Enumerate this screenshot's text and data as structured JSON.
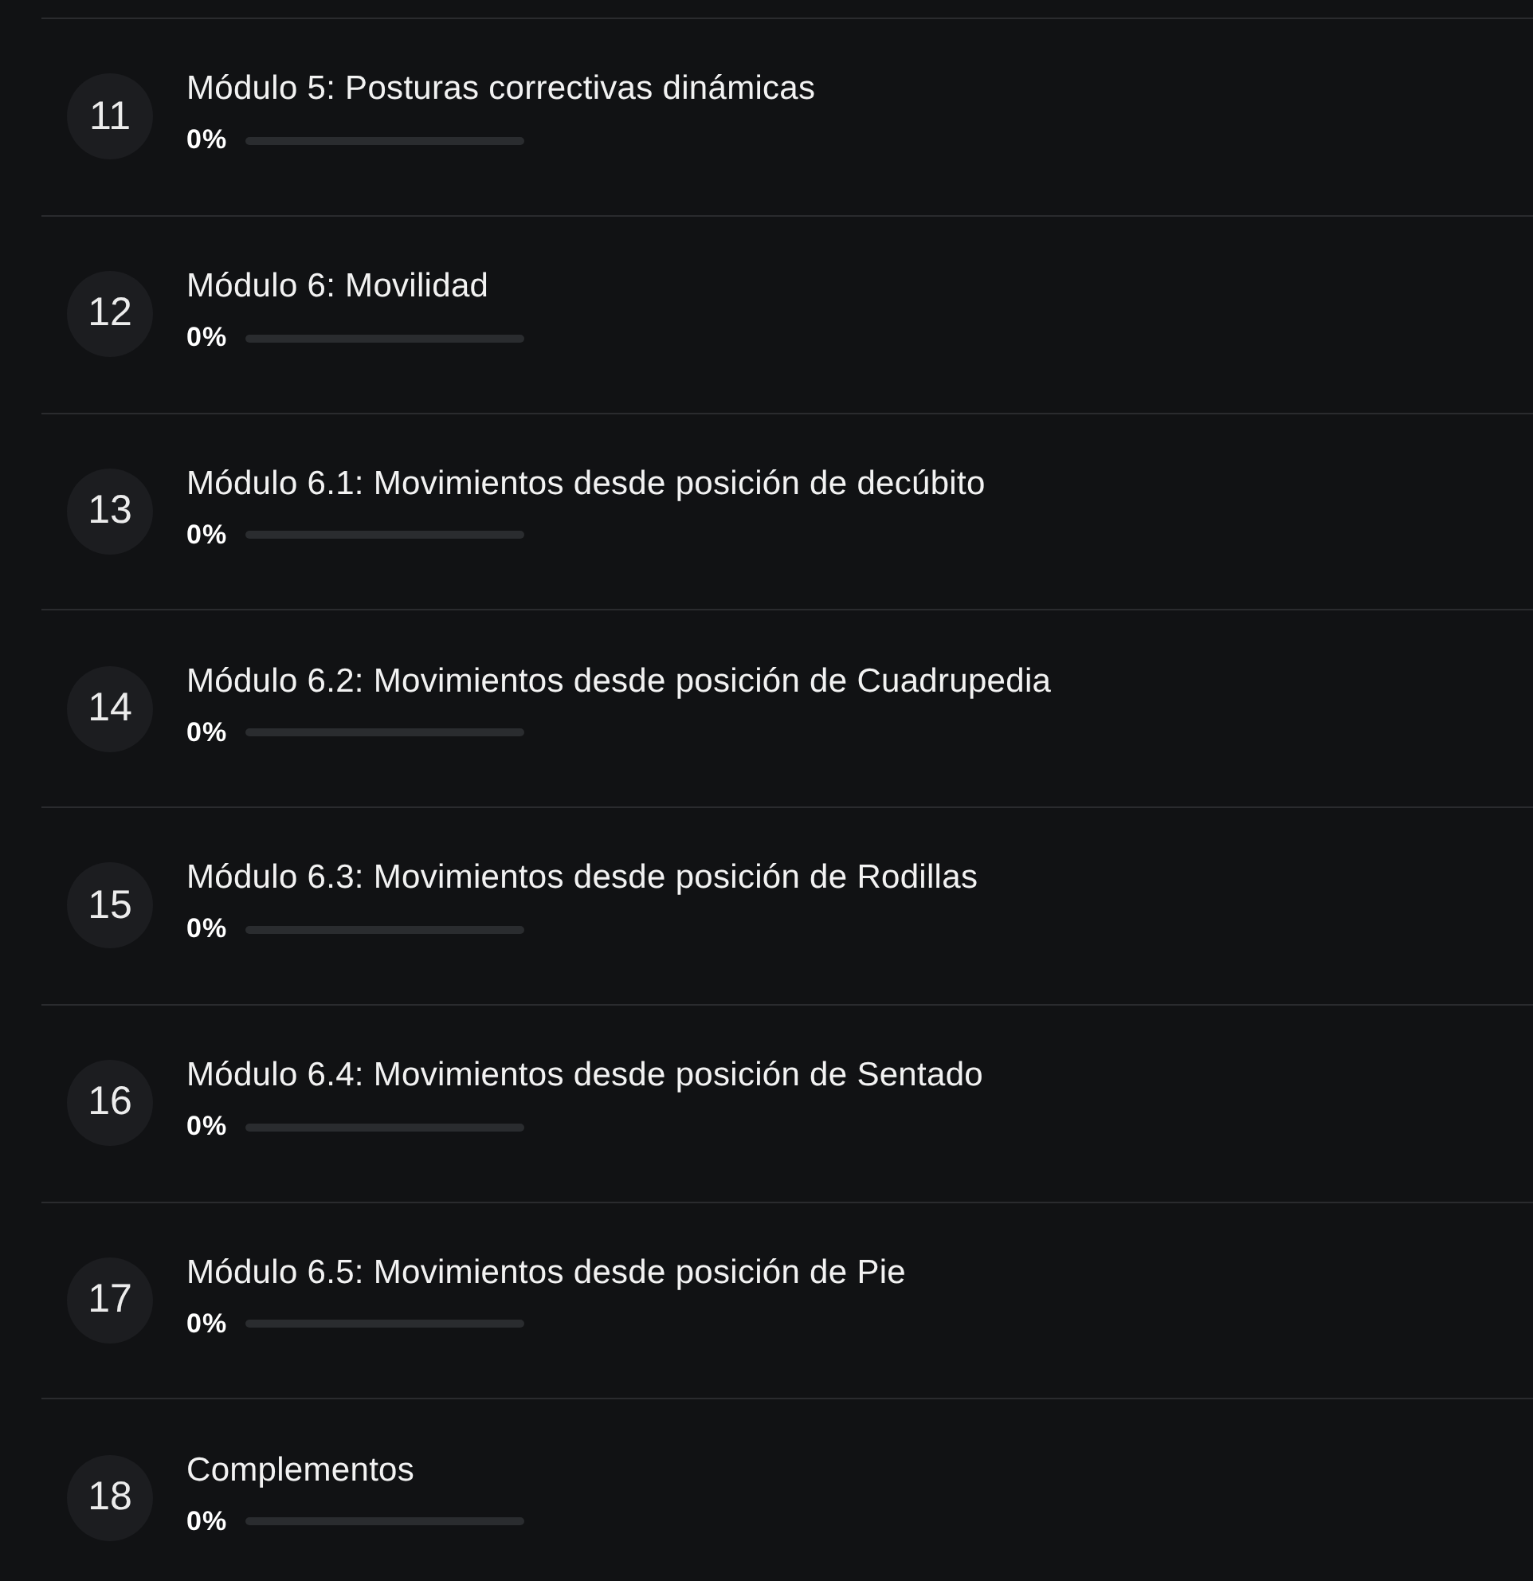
{
  "modules": [
    {
      "number": "11",
      "title": "Módulo 5: Posturas correctivas dinámicas",
      "percent": "0%",
      "level": 0
    },
    {
      "number": "12",
      "title": "Módulo 6: Movilidad",
      "percent": "0%",
      "level": 0
    },
    {
      "number": "13",
      "title": "Módulo 6.1: Movimientos desde posición de decúbito",
      "percent": "0%",
      "level": 0
    },
    {
      "number": "14",
      "title": "Módulo 6.2: Movimientos desde posición de Cuadrupedia",
      "percent": "0%",
      "level": 0
    },
    {
      "number": "15",
      "title": "Módulo 6.3: Movimientos desde posición de Rodillas",
      "percent": "0%",
      "level": 0
    },
    {
      "number": "16",
      "title": "Módulo 6.4: Movimientos desde posición de Sentado",
      "percent": "0%",
      "level": 0
    },
    {
      "number": "17",
      "title": "Módulo 6.5: Movimientos desde posición de Pie",
      "percent": "0%",
      "level": 0
    },
    {
      "number": "18",
      "title": "Complementos",
      "percent": "0%",
      "level": 0
    }
  ]
}
